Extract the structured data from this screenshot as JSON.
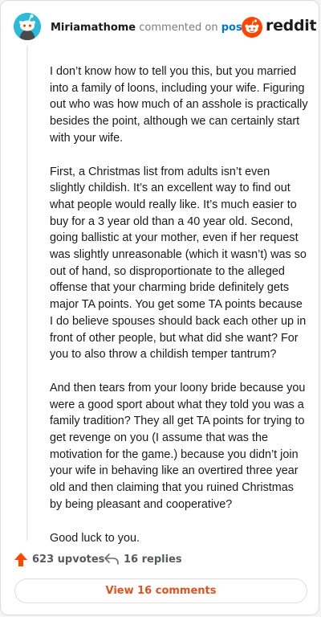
{
  "comment": {
    "username": "Miriamathome",
    "action": "commented on",
    "link_text": "post",
    "avatar_icon": "snoo-avatar-icon",
    "avatar_color": "#2bbbd8",
    "paragraphs": [
      "I don’t know how to tell you this, but you married into a family of loons, including your wife. Figuring out who was how much of an asshole is practically besides the point, although we can certainly start with your wife.",
      "First, a Christmas list from adults isn’t even slightly childish. It’s an excellent way to find out what people would really like. It’s much easier to buy for a 3 year old than a 40 year old. Second, going ballistic at your mother, even if her request was slightly unreasonable (which it wasn’t) was so out of hand, so disproportionate to the alleged offense that your charming bride definitely gets major TA points. You get some TA points because I do believe spouses should back each other up in front of other people, but what did she want? For you to also throw a childish temper tantrum?",
      "And then tears from your loony bride because you were a good sport about what they told you was a family tradition? They all get TA points for trying to get revenge on you (I assume that was the motivation for the game.) because you didn’t join your wife in behaving like an overtired three year old and then claiming that you ruined Christmas by being pleasant and cooperative?",
      "Good luck to you."
    ]
  },
  "brand": {
    "logo_text": "reddit",
    "logo_icon": "reddit-logo-icon",
    "brand_color": "#ff4500"
  },
  "footer": {
    "upvotes": "623 upvotes",
    "upvote_icon": "upvote-arrow-icon",
    "upvote_color": "#ff4500",
    "replies": "16 replies",
    "reply_icon": "reply-arrow-icon",
    "view_comments": "View 16 comments",
    "view_color": "#e0531e"
  }
}
